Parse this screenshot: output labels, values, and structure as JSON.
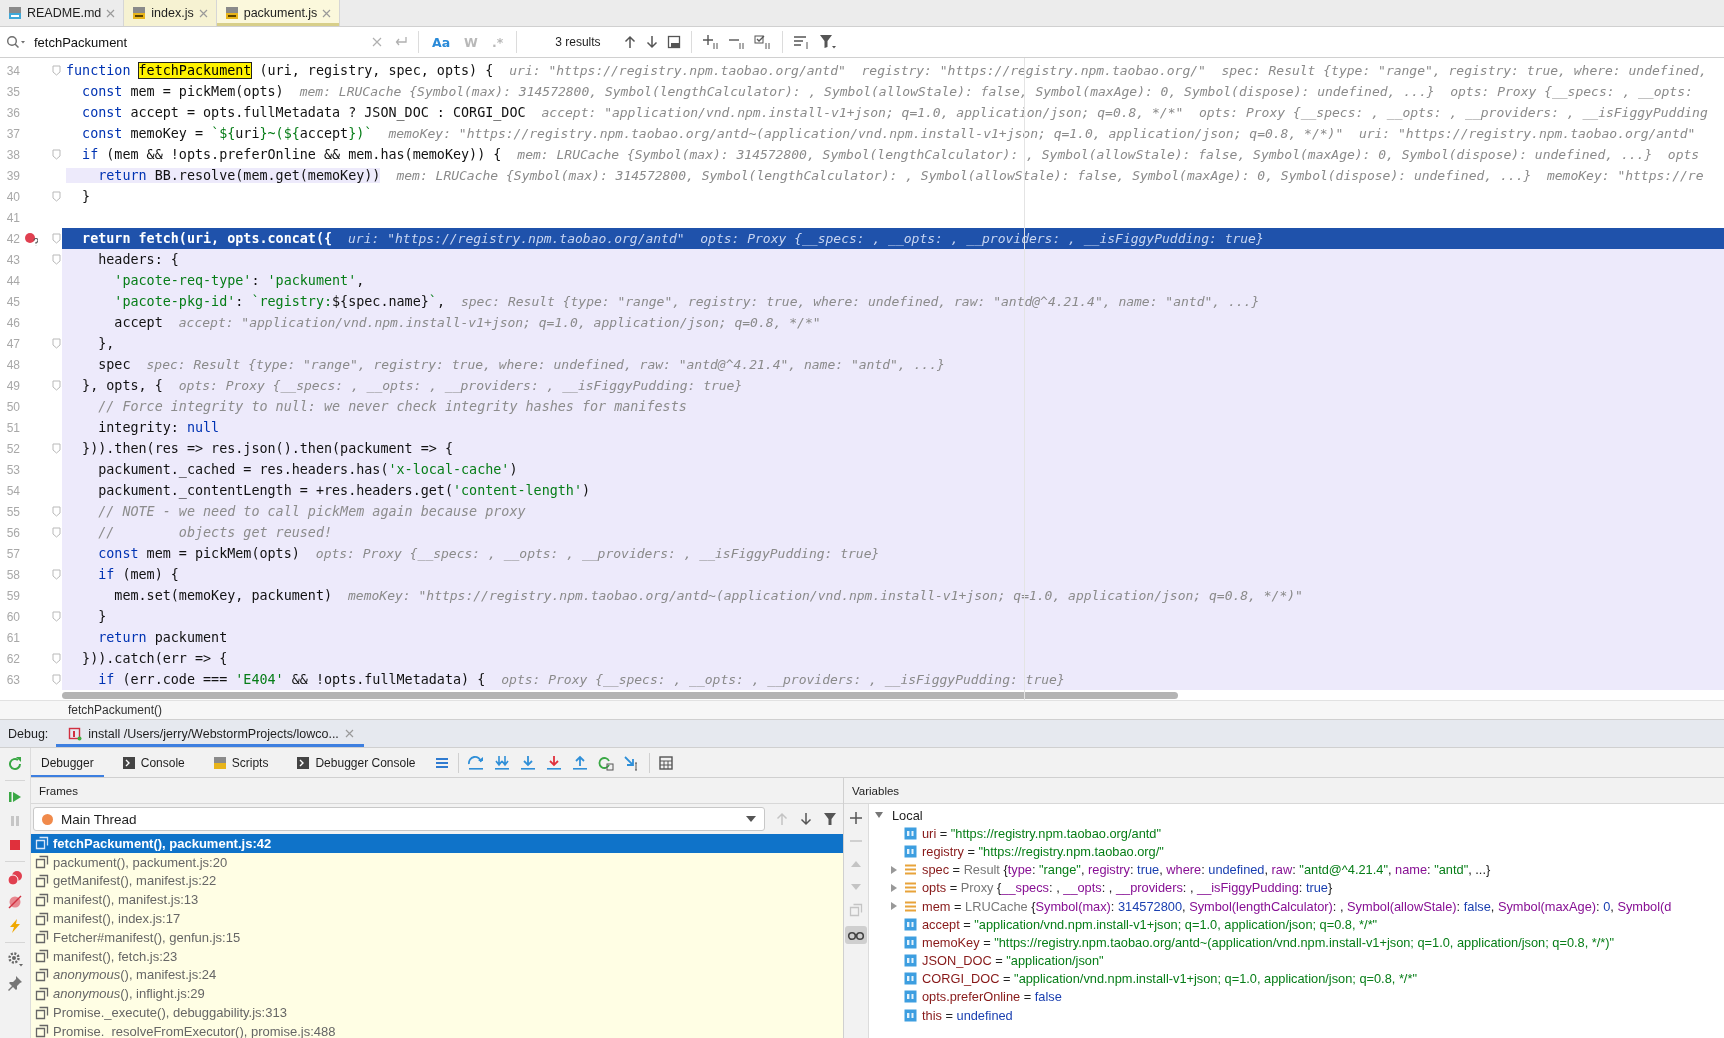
{
  "tabs": [
    {
      "label": "README.md",
      "kind": "md",
      "selected": false
    },
    {
      "label": "index.js",
      "kind": "js",
      "selected": false
    },
    {
      "label": "packument.js",
      "kind": "js",
      "selected": true
    }
  ],
  "search": {
    "value": "fetchPackument",
    "options": [
      {
        "label": "Aa",
        "selected": true
      },
      {
        "label": "W",
        "selected": false
      },
      {
        "label": ".*",
        "selected": false
      }
    ],
    "results": "3 results"
  },
  "editor": {
    "lines": [
      {
        "num": "34",
        "fold": true,
        "kind": "plain",
        "tokens": [
          {
            "kind": "kw",
            "text": "function "
          },
          {
            "kind": "match",
            "text": "fetchPackument"
          },
          {
            "kind": "p",
            "text": " (uri, registry, spec, opts) {"
          }
        ],
        "hint": "uri: \"https://registry.npm.taobao.org/antd\"  registry: \"https://registry.npm.taobao.org/\"  spec: Result {type: \"range\", registry: true, where: undefined,"
      },
      {
        "num": "35",
        "fold": false,
        "kind": "plain",
        "tokens": [
          {
            "kind": "kw",
            "text": "  const"
          },
          {
            "kind": "p",
            "text": " mem = pickMem(opts)"
          }
        ],
        "hint": "mem: LRUCache {Symbol(max): 314572800, Symbol(lengthCalculator): , Symbol(allowStale): false, Symbol(maxAge): 0, Symbol(dispose): undefined, ...}  opts: Proxy {__specs: , __opts:"
      },
      {
        "num": "36",
        "fold": false,
        "kind": "plain",
        "tokens": [
          {
            "kind": "kw",
            "text": "  const"
          },
          {
            "kind": "p",
            "text": " accept = opts.fullMetadata ? JSON_DOC : CORGI_DOC"
          }
        ],
        "hint": "accept: \"application/vnd.npm.install-v1+json; q=1.0, application/json; q=0.8, */*\"  opts: Proxy {__specs: , __opts: , __providers: , __isFiggyPudding"
      },
      {
        "num": "37",
        "fold": false,
        "kind": "plain",
        "tokens": [
          {
            "kind": "kw",
            "text": "  const"
          },
          {
            "kind": "p",
            "text": " memoKey = "
          },
          {
            "kind": "str",
            "text": "`${"
          },
          {
            "kind": "p",
            "text": "uri"
          },
          {
            "kind": "str",
            "text": "}~(${"
          },
          {
            "kind": "p",
            "text": "accept"
          },
          {
            "kind": "str",
            "text": "})`"
          }
        ],
        "hint": "memoKey: \"https://registry.npm.taobao.org/antd~(application/vnd.npm.install-v1+json; q=1.0, application/json; q=0.8, */*)\"  uri: \"https://registry.npm.taobao.org/antd\""
      },
      {
        "num": "38",
        "fold": true,
        "kind": "plain",
        "tokens": [
          {
            "kind": "kw",
            "text": "  if"
          },
          {
            "kind": "p",
            "text": " (mem && !opts.preferOnline && mem.has(memoKey)) {"
          }
        ],
        "hint": "mem: LRUCache {Symbol(max): 314572800, Symbol(lengthCalculator): , Symbol(allowStale): false, Symbol(maxAge): 0, Symbol(dispose): undefined, ...}  opts"
      },
      {
        "num": "39",
        "fold": false,
        "kind": "inline",
        "tokens": [
          {
            "kind": "kw",
            "text": "    return"
          },
          {
            "kind": "p",
            "text": " BB.resolve(mem.get(memoKey))"
          }
        ],
        "hint": "mem: LRUCache {Symbol(max): 314572800, Symbol(lengthCalculator): , Symbol(allowStale): false, Symbol(maxAge): 0, Symbol(dispose): undefined, ...}  memoKey: \"https://re"
      },
      {
        "num": "40",
        "fold": true,
        "kind": "plain",
        "tokens": [
          {
            "kind": "p",
            "text": "  }"
          }
        ]
      },
      {
        "num": "41",
        "fold": false,
        "kind": "plain"
      },
      {
        "num": "42",
        "fold": true,
        "kind": "current",
        "tokens": [
          {
            "kind": "p",
            "text": "  return fetch(uri, opts.concat({"
          }
        ],
        "hint": "uri: \"https://registry.npm.taobao.org/antd\"  opts: Proxy {__specs: , __opts: , __providers: , __isFiggyPudding: true}"
      },
      {
        "num": "43",
        "fold": true,
        "kind": "block",
        "tokens": [
          {
            "kind": "p",
            "text": "    headers: {"
          }
        ]
      },
      {
        "num": "44",
        "fold": false,
        "kind": "block",
        "tokens": [
          {
            "kind": "str",
            "text": "      'pacote-req-type'"
          },
          {
            "kind": "p",
            "text": ": "
          },
          {
            "kind": "str",
            "text": "'packument'"
          },
          {
            "kind": "p",
            "text": ","
          }
        ]
      },
      {
        "num": "45",
        "fold": false,
        "kind": "block",
        "tokens": [
          {
            "kind": "str",
            "text": "      'pacote-pkg-id'"
          },
          {
            "kind": "p",
            "text": ": "
          },
          {
            "kind": "str",
            "text": "`registry:"
          },
          {
            "kind": "p",
            "text": "${spec.name}"
          },
          {
            "kind": "str",
            "text": "`"
          },
          {
            "kind": "p",
            "text": ","
          }
        ],
        "hint": "spec: Result {type: \"range\", registry: true, where: undefined, raw: \"antd@^4.21.4\", name: \"antd\", ...}"
      },
      {
        "num": "46",
        "fold": false,
        "kind": "block",
        "tokens": [
          {
            "kind": "p",
            "text": "      accept"
          }
        ],
        "hint": "accept: \"application/vnd.npm.install-v1+json; q=1.0, application/json; q=0.8, */*\""
      },
      {
        "num": "47",
        "fold": true,
        "kind": "block",
        "tokens": [
          {
            "kind": "p",
            "text": "    },"
          }
        ]
      },
      {
        "num": "48",
        "fold": false,
        "kind": "block",
        "tokens": [
          {
            "kind": "p",
            "text": "    spec"
          }
        ],
        "hint": "spec: Result {type: \"range\", registry: true, where: undefined, raw: \"antd@^4.21.4\", name: \"antd\", ...}"
      },
      {
        "num": "49",
        "fold": true,
        "kind": "block",
        "tokens": [
          {
            "kind": "p",
            "text": "  }, opts, {"
          }
        ],
        "hint": "opts: Proxy {__specs: , __opts: , __providers: , __isFiggyPudding: true}"
      },
      {
        "num": "50",
        "fold": false,
        "kind": "block",
        "tokens": [
          {
            "kind": "cm",
            "text": "    // Force integrity to null: we never check integrity hashes for manifests"
          }
        ]
      },
      {
        "num": "51",
        "fold": false,
        "kind": "block",
        "tokens": [
          {
            "kind": "p",
            "text": "    integrity: "
          },
          {
            "kind": "kw",
            "text": "null"
          }
        ]
      },
      {
        "num": "52",
        "fold": true,
        "kind": "block",
        "tokens": [
          {
            "kind": "p",
            "text": "  })).then(res => res.json().then(packument => {"
          }
        ]
      },
      {
        "num": "53",
        "fold": false,
        "kind": "block",
        "tokens": [
          {
            "kind": "p",
            "text": "    packument._cached = res.headers.has("
          },
          {
            "kind": "str",
            "text": "'x-local-cache'"
          },
          {
            "kind": "p",
            "text": ")"
          }
        ]
      },
      {
        "num": "54",
        "fold": false,
        "kind": "block",
        "tokens": [
          {
            "kind": "p",
            "text": "    packument._contentLength = +res.headers.get("
          },
          {
            "kind": "str",
            "text": "'content-length'"
          },
          {
            "kind": "p",
            "text": ")"
          }
        ]
      },
      {
        "num": "55",
        "fold": true,
        "kind": "block",
        "tokens": [
          {
            "kind": "cm",
            "text": "    // NOTE - we need to call pickMem again because proxy"
          }
        ]
      },
      {
        "num": "56",
        "fold": true,
        "kind": "block",
        "tokens": [
          {
            "kind": "cm",
            "text": "    //        objects get reused!"
          }
        ]
      },
      {
        "num": "57",
        "fold": false,
        "kind": "block",
        "tokens": [
          {
            "kind": "kw",
            "text": "    const"
          },
          {
            "kind": "p",
            "text": " mem = pickMem(opts)"
          }
        ],
        "hint": "opts: Proxy {__specs: , __opts: , __providers: , __isFiggyPudding: true}"
      },
      {
        "num": "58",
        "fold": true,
        "kind": "block",
        "tokens": [
          {
            "kind": "kw",
            "text": "    if"
          },
          {
            "kind": "p",
            "text": " (mem) {"
          }
        ]
      },
      {
        "num": "59",
        "fold": false,
        "kind": "block",
        "tokens": [
          {
            "kind": "p",
            "text": "      mem.set(memoKey, packument)"
          }
        ],
        "hint": "memoKey: \"https://registry.npm.taobao.org/antd~(application/vnd.npm.install-v1+json; q=1.0, application/json; q=0.8, */*)\""
      },
      {
        "num": "60",
        "fold": true,
        "kind": "block",
        "tokens": [
          {
            "kind": "p",
            "text": "    }"
          }
        ]
      },
      {
        "num": "61",
        "fold": false,
        "kind": "block",
        "tokens": [
          {
            "kind": "kw",
            "text": "    return"
          },
          {
            "kind": "p",
            "text": " packument"
          }
        ]
      },
      {
        "num": "62",
        "fold": true,
        "kind": "block",
        "tokens": [
          {
            "kind": "p",
            "text": "  })).catch(err => {"
          }
        ]
      },
      {
        "num": "63",
        "fold": true,
        "kind": "block",
        "tokens": [
          {
            "kind": "kw",
            "text": "    if"
          },
          {
            "kind": "p",
            "text": " (err.code === "
          },
          {
            "kind": "str",
            "text": "'E404'"
          },
          {
            "kind": "p",
            "text": " && !opts.fullMetadata) {"
          }
        ],
        "hint": "opts: Proxy {__specs: , __opts: , __providers: , __isFiggyPudding: true}"
      }
    ],
    "breadcrumb": "fetchPackument()"
  },
  "debug": {
    "label": "Debug:",
    "session": "install /Users/jerry/WebstormProjects/lowco...",
    "tabs": [
      {
        "label": "Debugger",
        "kind": "debugger",
        "selected": true
      },
      {
        "label": "Console",
        "kind": "console",
        "selected": false
      },
      {
        "label": "Scripts",
        "kind": "scripts",
        "selected": false
      },
      {
        "label": "Debugger Console",
        "kind": "console",
        "selected": false
      }
    ],
    "frames_title": "Frames",
    "thread": "Main Thread",
    "frames": [
      {
        "text": "fetchPackument(), packument.js:42",
        "selected": true
      },
      {
        "text": "packument(), packument.js:20",
        "selected": false
      },
      {
        "text": "getManifest(), manifest.js:22",
        "selected": false
      },
      {
        "text": "manifest(), manifest.js:13",
        "selected": false
      },
      {
        "text": "manifest(), index.js:17",
        "selected": false
      },
      {
        "text": "Fetcher#manifest(), genfun.js:15",
        "selected": false
      },
      {
        "text": "manifest(), fetch.js:23",
        "selected": false
      },
      {
        "text": "*anonymous*(), manifest.js:24",
        "selected": false
      },
      {
        "text": "*anonymous*(), inflight.js:29",
        "selected": false
      },
      {
        "text": "Promise._execute(), debuggability.js:313",
        "selected": false
      },
      {
        "text": "Promise._resolveFromExecutor(), promise.js:488",
        "selected": false
      }
    ],
    "variables_title": "Variables",
    "scope": {
      "label": "Local",
      "expanded": true
    },
    "variables": [
      {
        "kind": "primitive",
        "tokens": [
          {
            "kind": "name",
            "text": "uri"
          },
          {
            "kind": "p",
            "text": " = "
          },
          {
            "kind": "str",
            "text": "\"https://registry.npm.taobao.org/antd\""
          }
        ]
      },
      {
        "kind": "primitive",
        "tokens": [
          {
            "kind": "name",
            "text": "registry"
          },
          {
            "kind": "p",
            "text": " = "
          },
          {
            "kind": "str",
            "text": "\"https://registry.npm.taobao.org/\""
          }
        ]
      },
      {
        "kind": "object",
        "expanded": false,
        "tokens": [
          {
            "kind": "name",
            "text": "spec"
          },
          {
            "kind": "p",
            "text": " = "
          },
          {
            "kind": "type",
            "text": "Result "
          },
          {
            "kind": "p",
            "text": "{"
          },
          {
            "kind": "key",
            "text": "type"
          },
          {
            "kind": "p",
            "text": ": "
          },
          {
            "kind": "str",
            "text": "\"range\""
          },
          {
            "kind": "p",
            "text": ", "
          },
          {
            "kind": "key",
            "text": "registry"
          },
          {
            "kind": "p",
            "text": ": "
          },
          {
            "kind": "kw",
            "text": "true"
          },
          {
            "kind": "p",
            "text": ", "
          },
          {
            "kind": "key",
            "text": "where"
          },
          {
            "kind": "p",
            "text": ": "
          },
          {
            "kind": "kw",
            "text": "undefined"
          },
          {
            "kind": "p",
            "text": ", "
          },
          {
            "kind": "key",
            "text": "raw"
          },
          {
            "kind": "p",
            "text": ": "
          },
          {
            "kind": "str",
            "text": "\"antd@^4.21.4\""
          },
          {
            "kind": "p",
            "text": ", "
          },
          {
            "kind": "key",
            "text": "name"
          },
          {
            "kind": "p",
            "text": ": "
          },
          {
            "kind": "str",
            "text": "\"antd\""
          },
          {
            "kind": "p",
            "text": ", ...}"
          }
        ]
      },
      {
        "kind": "object",
        "expanded": false,
        "tokens": [
          {
            "kind": "name",
            "text": "opts"
          },
          {
            "kind": "p",
            "text": " = "
          },
          {
            "kind": "type",
            "text": "Proxy "
          },
          {
            "kind": "p",
            "text": "{"
          },
          {
            "kind": "key",
            "text": "__specs"
          },
          {
            "kind": "p",
            "text": ": , "
          },
          {
            "kind": "key",
            "text": "__opts"
          },
          {
            "kind": "p",
            "text": ": , "
          },
          {
            "kind": "key",
            "text": "__providers"
          },
          {
            "kind": "p",
            "text": ": , "
          },
          {
            "kind": "key",
            "text": "__isFiggyPudding"
          },
          {
            "kind": "p",
            "text": ": "
          },
          {
            "kind": "kw",
            "text": "true"
          },
          {
            "kind": "p",
            "text": "}"
          }
        ]
      },
      {
        "kind": "object",
        "expanded": false,
        "tokens": [
          {
            "kind": "name",
            "text": "mem"
          },
          {
            "kind": "p",
            "text": " = "
          },
          {
            "kind": "type",
            "text": "LRUCache "
          },
          {
            "kind": "p",
            "text": "{"
          },
          {
            "kind": "key",
            "text": "Symbol(max)"
          },
          {
            "kind": "p",
            "text": ": "
          },
          {
            "kind": "kw",
            "text": "314572800"
          },
          {
            "kind": "p",
            "text": ", "
          },
          {
            "kind": "key",
            "text": "Symbol(lengthCalculator)"
          },
          {
            "kind": "p",
            "text": ": , "
          },
          {
            "kind": "key",
            "text": "Symbol(allowStale)"
          },
          {
            "kind": "p",
            "text": ": "
          },
          {
            "kind": "kw",
            "text": "false"
          },
          {
            "kind": "p",
            "text": ", "
          },
          {
            "kind": "key",
            "text": "Symbol(maxAge)"
          },
          {
            "kind": "p",
            "text": ": "
          },
          {
            "kind": "kw",
            "text": "0"
          },
          {
            "kind": "p",
            "text": ", "
          },
          {
            "kind": "key",
            "text": "Symbol(d"
          }
        ]
      },
      {
        "kind": "primitive",
        "tokens": [
          {
            "kind": "name",
            "text": "accept"
          },
          {
            "kind": "p",
            "text": " = "
          },
          {
            "kind": "str",
            "text": "\"application/vnd.npm.install-v1+json; q=1.0, application/json; q=0.8, */*\""
          }
        ]
      },
      {
        "kind": "primitive",
        "tokens": [
          {
            "kind": "name",
            "text": "memoKey"
          },
          {
            "kind": "p",
            "text": " = "
          },
          {
            "kind": "str",
            "text": "\"https://registry.npm.taobao.org/antd~(application/vnd.npm.install-v1+json; q=1.0, application/json; q=0.8, */*)\""
          }
        ]
      },
      {
        "kind": "primitive",
        "tokens": [
          {
            "kind": "name",
            "text": "JSON_DOC"
          },
          {
            "kind": "p",
            "text": " = "
          },
          {
            "kind": "str",
            "text": "\"application/json\""
          }
        ]
      },
      {
        "kind": "primitive",
        "tokens": [
          {
            "kind": "name",
            "text": "CORGI_DOC"
          },
          {
            "kind": "p",
            "text": " = "
          },
          {
            "kind": "str",
            "text": "\"application/vnd.npm.install-v1+json; q=1.0, application/json; q=0.8, */*\""
          }
        ]
      },
      {
        "kind": "primitive",
        "tokens": [
          {
            "kind": "name",
            "text": "opts.preferOnline"
          },
          {
            "kind": "p",
            "text": " = "
          },
          {
            "kind": "kw",
            "text": "false"
          }
        ]
      },
      {
        "kind": "primitive",
        "tokens": [
          {
            "kind": "name",
            "text": "this"
          },
          {
            "kind": "p",
            "text": " = "
          },
          {
            "kind": "kw",
            "text": "undefined"
          }
        ]
      }
    ]
  }
}
